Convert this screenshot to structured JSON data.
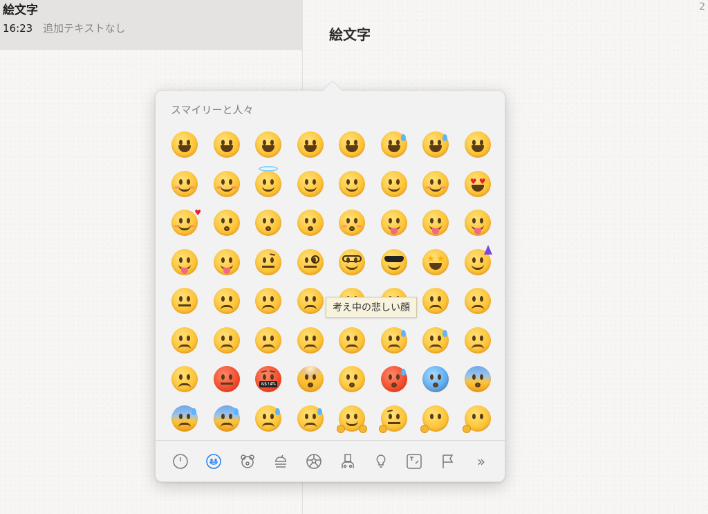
{
  "sidebar": {
    "note": {
      "title": "絵文字",
      "time": "16:23",
      "preview": "追加テキストなし"
    }
  },
  "editor": {
    "title": "絵文字",
    "corner_number": "2"
  },
  "picker": {
    "section_title": "スマイリーと人々",
    "tooltip": "考え中の悲しい顔",
    "emoji_grid": [
      [
        "grinning-face",
        "grinning-face-big-eyes",
        "grinning-face-smiling-eyes",
        "beaming-face",
        "grinning-squinting-face",
        "grinning-face-sweat",
        "face-tears-of-joy",
        "rolling-on-floor-laughing"
      ],
      [
        "smiling-face",
        "smiling-face-smiling-eyes",
        "smiling-face-halo",
        "slightly-smiling-face",
        "upside-down-face",
        "winking-face",
        "relieved-face",
        "smiling-face-heart-eyes"
      ],
      [
        "smiling-face-hearts",
        "face-blowing-kiss",
        "kissing-face",
        "kissing-face-smiling-eyes",
        "kissing-face-closed-eyes",
        "face-savoring-food",
        "face-with-tongue",
        "squinting-face-tongue"
      ],
      [
        "winking-face-tongue",
        "zany-face",
        "face-raised-eyebrow",
        "face-with-monocle",
        "nerd-face",
        "smiling-face-sunglasses",
        "star-struck",
        "partying-face"
      ],
      [
        "smirking-face",
        "unamused-face",
        "disappointed-face",
        "pensive-face",
        "worried-face",
        "confused-face",
        "slightly-frowning-face",
        "frowning-face"
      ],
      [
        "confounded-face",
        "persevering-face",
        "tired-face",
        "weary-face",
        "pleading-face",
        "crying-face",
        "loudly-crying-face",
        "face-steam-nose"
      ],
      [
        "angry-face",
        "pouting-face",
        "face-symbols-mouth",
        "exploding-head",
        "flushed-face",
        "hot-face",
        "cold-face",
        "face-screaming-fear"
      ],
      [
        "anxious-face-sweat",
        "downcast-face-sweat",
        "sad-relieved-face",
        "face-with-sweat",
        "hugging-face",
        "thinking-face",
        "face-hand-over-mouth",
        "shushing-face"
      ]
    ],
    "censor_text": "&$!#%",
    "tabs": [
      {
        "name": "tab-recent",
        "icon": "clock-icon",
        "active": false
      },
      {
        "name": "tab-smileys",
        "icon": "smiley-icon",
        "active": true
      },
      {
        "name": "tab-animals",
        "icon": "bear-icon",
        "active": false
      },
      {
        "name": "tab-food",
        "icon": "burger-icon",
        "active": false
      },
      {
        "name": "tab-activity",
        "icon": "soccer-ball-icon",
        "active": false
      },
      {
        "name": "tab-travel",
        "icon": "building-icon",
        "active": false
      },
      {
        "name": "tab-objects",
        "icon": "lightbulb-icon",
        "active": false
      },
      {
        "name": "tab-symbols",
        "icon": "symbols-icon",
        "active": false
      },
      {
        "name": "tab-flags",
        "icon": "flag-icon",
        "active": false
      },
      {
        "name": "tab-more",
        "icon": "chevrons-right-icon",
        "active": false
      }
    ]
  },
  "colors": {
    "accent": "#1f7ef0",
    "sidebar_selected": "#e4e3e1",
    "tooltip_bg": "#f7f3de"
  }
}
